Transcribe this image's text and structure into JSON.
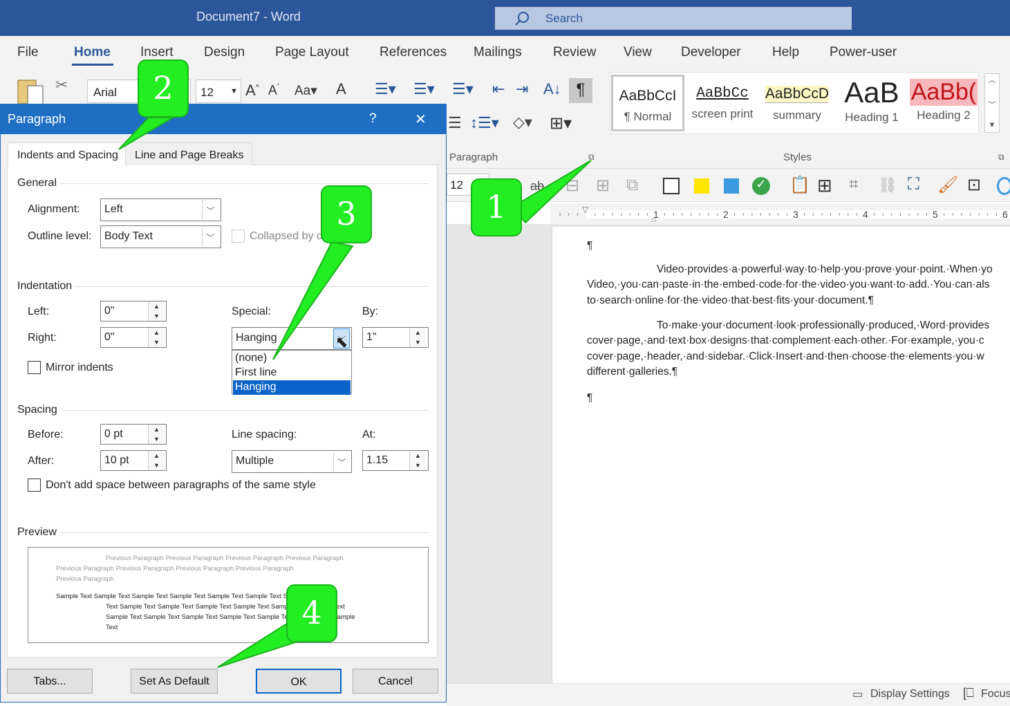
{
  "titlebar": {
    "title": "Document7  -  Word",
    "search": "Search"
  },
  "menu": [
    "File",
    "Home",
    "Insert",
    "Design",
    "Page Layout",
    "References",
    "Mailings",
    "Review",
    "View",
    "Developer",
    "Help",
    "Power-user"
  ],
  "ribbon": {
    "font_name": "Arial",
    "font_size": "12",
    "font_size_qat": "12",
    "paragraph_group": "Paragraph",
    "styles_group": "Styles",
    "styles": [
      {
        "sample": "AaBbCcI",
        "name": "¶ Normal"
      },
      {
        "sample": "AaBbCc",
        "name": "screen print"
      },
      {
        "sample": "AaBbCcD",
        "name": "summary"
      },
      {
        "sample": "AaB",
        "name": "Heading 1"
      },
      {
        "sample": "AaBb(",
        "name": "Heading 2"
      }
    ],
    "ruler_marks": [
      "1",
      "2",
      "3",
      "4",
      "5",
      "6"
    ]
  },
  "document": {
    "pilcrow": "¶",
    "para1": [
      "Video·provides·a·powerful·way·to·help·you·prove·your·point.·When·yo",
      "Video,·you·can·paste·in·the·embed·code·for·the·video·you·want·to·add.·You·can·als",
      "to·search·online·for·the·video·that·best·fits·your·document.¶"
    ],
    "para2": [
      "To·make·your·document·look·professionally·produced,·Word·provides",
      "cover·page,·and·text·box·designs·that·complement·each·other.·For·example,·you·c",
      "cover·page,·header,·and·sidebar.·Click·Insert·and·then·choose·the·elements·you·w",
      "different·galleries.¶"
    ]
  },
  "status": {
    "display_settings": "Display Settings",
    "focus": "Focus"
  },
  "dialog": {
    "title": "Paragraph",
    "help": "?",
    "close": "✕",
    "tabs": [
      "Indents and Spacing",
      "Line and Page Breaks"
    ],
    "general": {
      "heading": "General",
      "alignment_label": "Alignment:",
      "alignment": "Left",
      "outline_label": "Outline level:",
      "outline": "Body Text",
      "collapsed": "Collapsed by de"
    },
    "indentation": {
      "heading": "Indentation",
      "left_label": "Left:",
      "left": "0\"",
      "right_label": "Right:",
      "right": "0\"",
      "special_label": "Special:",
      "special": "Hanging",
      "by_label": "By:",
      "by": "1\"",
      "mirror": "Mirror indents",
      "options": [
        "(none)",
        "First line",
        "Hanging"
      ]
    },
    "spacing": {
      "heading": "Spacing",
      "before_label": "Before:",
      "before": "0 pt",
      "after_label": "After:",
      "after": "10 pt",
      "line_label": "Line spacing:",
      "line": "Multiple",
      "at_label": "At:",
      "at": "1.15",
      "dont_add": "Don't add space between paragraphs of the same style"
    },
    "preview": {
      "heading": "Preview",
      "prev": [
        "Previous Paragraph Previous Paragraph Previous Paragraph Previous Paragraph",
        "Previous Paragraph Previous Paragraph Previous Paragraph Previous Paragraph",
        "Previous Paragraph"
      ],
      "sample": [
        "Sample Text Sample Text Sample Text Sample Text Sample Text Sample Text Sample",
        "Text Sample Text Sample Text Sample Text Sample Text Sample Text Sample Text",
        "Sample Text Sample Text Sample Text Sample Text Sample Text Sample Text Sample",
        "Text"
      ]
    },
    "buttons": {
      "tabs": "Tabs...",
      "default": "Set As Default",
      "ok": "OK",
      "cancel": "Cancel"
    }
  },
  "callouts": [
    "1",
    "2",
    "3",
    "4"
  ],
  "colors": {
    "title_blue": "#2b579a",
    "dialog_blue": "#1e6fc4",
    "callout_green": "#22ee22",
    "selection": "#0a63c9"
  }
}
